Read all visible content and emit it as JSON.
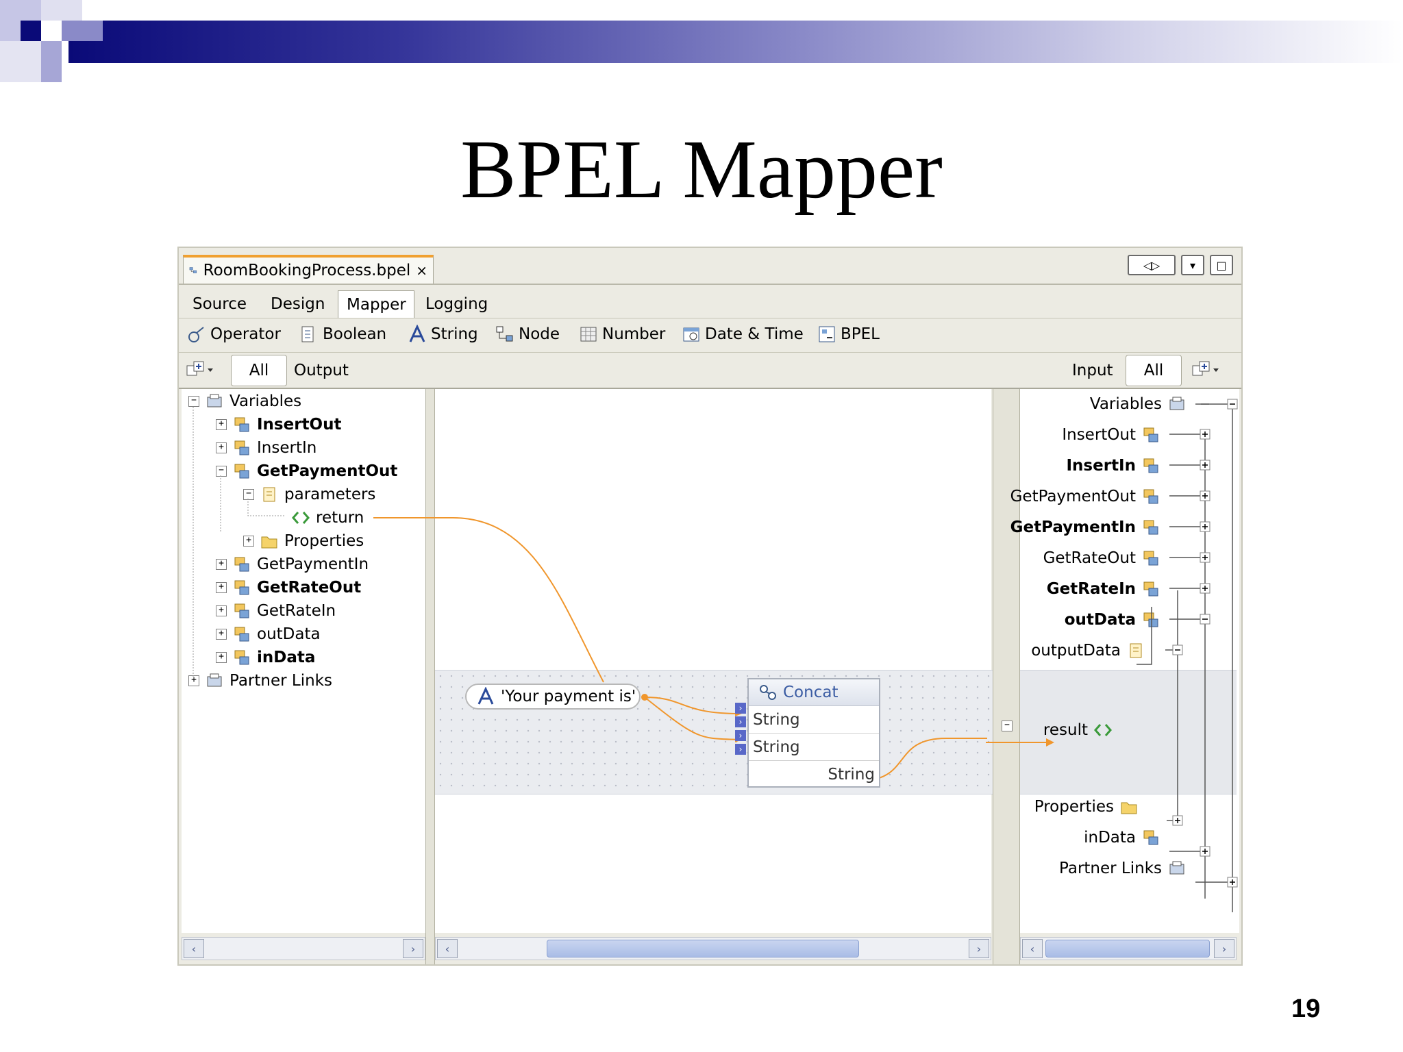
{
  "slide": {
    "title": "BPEL Mapper",
    "page_number": "19"
  },
  "editor_tab": {
    "label": "RoomBookingProcess.bpel",
    "close": "×"
  },
  "window_controls": {
    "left": "◁",
    "right": "▷",
    "menu": "▾",
    "maximize": "□"
  },
  "view_tabs": [
    "Source",
    "Design",
    "Mapper",
    "Logging"
  ],
  "palette": [
    "Operator",
    "Boolean",
    "String",
    "Node",
    "Number",
    "Date & Time",
    "BPEL"
  ],
  "filter": {
    "left_all": "All",
    "left_label": "Output",
    "right_label": "Input",
    "right_all": "All"
  },
  "left_tree": {
    "variables": "Variables",
    "items": [
      "InsertOut",
      "InsertIn",
      "GetPaymentOut",
      "parameters",
      "return",
      "Properties",
      "GetPaymentIn",
      "GetRateOut",
      "GetRateIn",
      "outData",
      "inData"
    ],
    "partner_links": "Partner Links"
  },
  "right_tree": {
    "variables": "Variables",
    "items": [
      "InsertOut",
      "InsertIn",
      "GetPaymentOut",
      "GetPaymentIn",
      "GetRateOut",
      "GetRateIn",
      "outData",
      "outputData",
      "result",
      "Properties",
      "inData"
    ],
    "partner_links": "Partner Links"
  },
  "canvas": {
    "literal": "'Your payment is'",
    "concat": {
      "title": "Concat",
      "inputs": [
        "String",
        "String"
      ],
      "output": "String"
    }
  },
  "colors": {
    "link": "#f0962c",
    "header_dark": "#0a0a78",
    "accent_tab": "#f0a030"
  }
}
